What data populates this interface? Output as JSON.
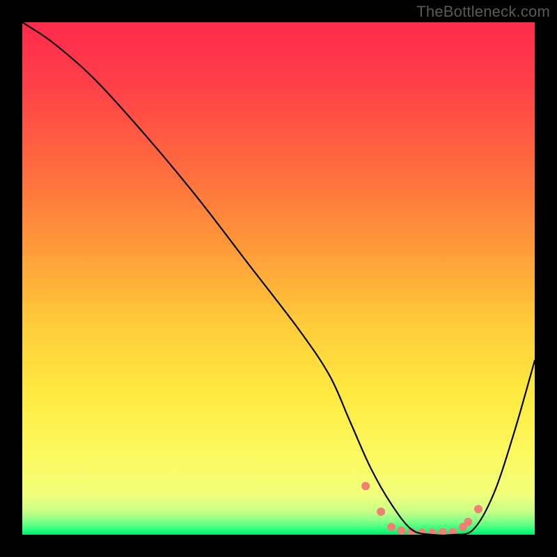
{
  "watermark": "TheBottleneck.com",
  "gradient": {
    "stops": [
      {
        "offset": 0.0,
        "color": "#ff2a4d"
      },
      {
        "offset": 0.12,
        "color": "#ff3f48"
      },
      {
        "offset": 0.28,
        "color": "#ff6a3f"
      },
      {
        "offset": 0.44,
        "color": "#ff9a3a"
      },
      {
        "offset": 0.58,
        "color": "#ffc93a"
      },
      {
        "offset": 0.72,
        "color": "#ffe93f"
      },
      {
        "offset": 0.84,
        "color": "#fdf95e"
      },
      {
        "offset": 0.92,
        "color": "#f2ff7a"
      },
      {
        "offset": 0.955,
        "color": "#c9ff86"
      },
      {
        "offset": 0.975,
        "color": "#7dff86"
      },
      {
        "offset": 0.99,
        "color": "#2aff7a"
      },
      {
        "offset": 1.0,
        "color": "#00e86b"
      }
    ]
  },
  "chart_data": {
    "type": "line",
    "title": "",
    "xlabel": "",
    "ylabel": "",
    "xlim": [
      0,
      100
    ],
    "ylim": [
      0,
      100
    ],
    "series": [
      {
        "name": "bottleneck-curve",
        "x": [
          0,
          6,
          14,
          24,
          34,
          44,
          54,
          60,
          64,
          68,
          72,
          76,
          80,
          84,
          88,
          92,
          96,
          100
        ],
        "y": [
          100,
          96,
          89,
          78,
          66,
          53,
          40,
          31,
          22,
          13,
          6,
          1,
          0,
          0,
          1,
          8,
          20,
          34
        ]
      }
    ],
    "dots": {
      "name": "optimal-range",
      "x": [
        67,
        70,
        72,
        74,
        76,
        78,
        80,
        82,
        84,
        86,
        87,
        89
      ],
      "y": [
        9.5,
        4.5,
        1.5,
        0.8,
        0.5,
        0.4,
        0.4,
        0.5,
        0.5,
        1.5,
        2.5,
        5
      ],
      "color": "#f08074",
      "radius": 6
    }
  }
}
